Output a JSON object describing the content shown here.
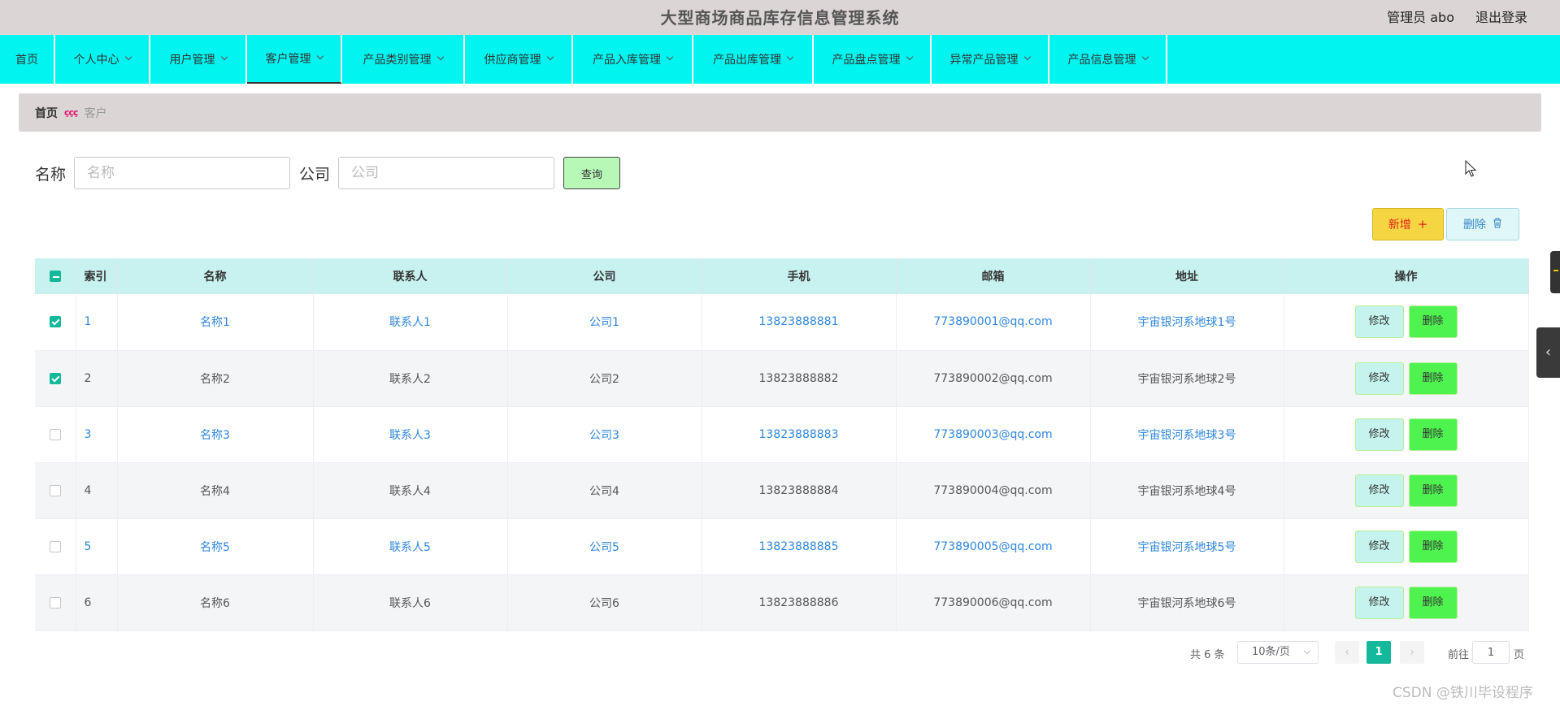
{
  "header": {
    "title": "大型商场商品库存信息管理系统",
    "user": "管理员 abo",
    "logout": "退出登录"
  },
  "nav": [
    {
      "label": "首页",
      "dropdown": false
    },
    {
      "label": "个人中心",
      "dropdown": true
    },
    {
      "label": "用户管理",
      "dropdown": true
    },
    {
      "label": "客户管理",
      "dropdown": true
    },
    {
      "label": "产品类别管理",
      "dropdown": true
    },
    {
      "label": "供应商管理",
      "dropdown": true
    },
    {
      "label": "产品入库管理",
      "dropdown": true
    },
    {
      "label": "产品出库管理",
      "dropdown": true
    },
    {
      "label": "产品盘点管理",
      "dropdown": true
    },
    {
      "label": "异常产品管理",
      "dropdown": true
    },
    {
      "label": "产品信息管理",
      "dropdown": true
    }
  ],
  "breadcrumb": {
    "home": "首页",
    "separator": "ççç",
    "current": "客户"
  },
  "search": {
    "name_label": "名称",
    "name_placeholder": "名称",
    "name_value": "",
    "company_label": "公司",
    "company_placeholder": "公司",
    "company_value": "",
    "query_button": "查询"
  },
  "actions": {
    "add_label": "新增",
    "add_icon": "plus-icon",
    "delete_label": "删除",
    "delete_icon": "trash-icon"
  },
  "table": {
    "columns": [
      "索引",
      "名称",
      "联系人",
      "公司",
      "手机",
      "邮箱",
      "地址",
      "操作"
    ],
    "header_checkbox": "indeterminate",
    "rows": [
      {
        "selected": true,
        "index": "1",
        "name": "名称1",
        "contact": "联系人1",
        "company": "公司1",
        "phone": "13823888881",
        "email": "773890001@qq.com",
        "address": "宇宙银河系地球1号"
      },
      {
        "selected": true,
        "index": "2",
        "name": "名称2",
        "contact": "联系人2",
        "company": "公司2",
        "phone": "13823888882",
        "email": "773890002@qq.com",
        "address": "宇宙银河系地球2号"
      },
      {
        "selected": false,
        "index": "3",
        "name": "名称3",
        "contact": "联系人3",
        "company": "公司3",
        "phone": "13823888883",
        "email": "773890003@qq.com",
        "address": "宇宙银河系地球3号"
      },
      {
        "selected": false,
        "index": "4",
        "name": "名称4",
        "contact": "联系人4",
        "company": "公司4",
        "phone": "13823888884",
        "email": "773890004@qq.com",
        "address": "宇宙银河系地球4号"
      },
      {
        "selected": false,
        "index": "5",
        "name": "名称5",
        "contact": "联系人5",
        "company": "公司5",
        "phone": "13823888885",
        "email": "773890005@qq.com",
        "address": "宇宙银河系地球5号"
      },
      {
        "selected": false,
        "index": "6",
        "name": "名称6",
        "contact": "联系人6",
        "company": "公司6",
        "phone": "13823888886",
        "email": "773890006@qq.com",
        "address": "宇宙银河系地球6号"
      }
    ],
    "row_link_style": [
      true,
      false,
      true,
      false,
      true,
      false
    ],
    "edit_label": "修改",
    "delete_label": "删除"
  },
  "pagination": {
    "total": "共 6 条",
    "page_size": "10条/页",
    "current_page": "1",
    "goto_label": "前往",
    "goto_value": "1",
    "page_suffix": "页"
  },
  "watermark": "CSDN @铁川毕设程序",
  "colors": {
    "nav_bg": "#00f5f0",
    "header_bg": "#dbd5d5",
    "table_header_bg": "#c7f2ef",
    "accent": "#13b99a",
    "link": "#2e86de"
  }
}
